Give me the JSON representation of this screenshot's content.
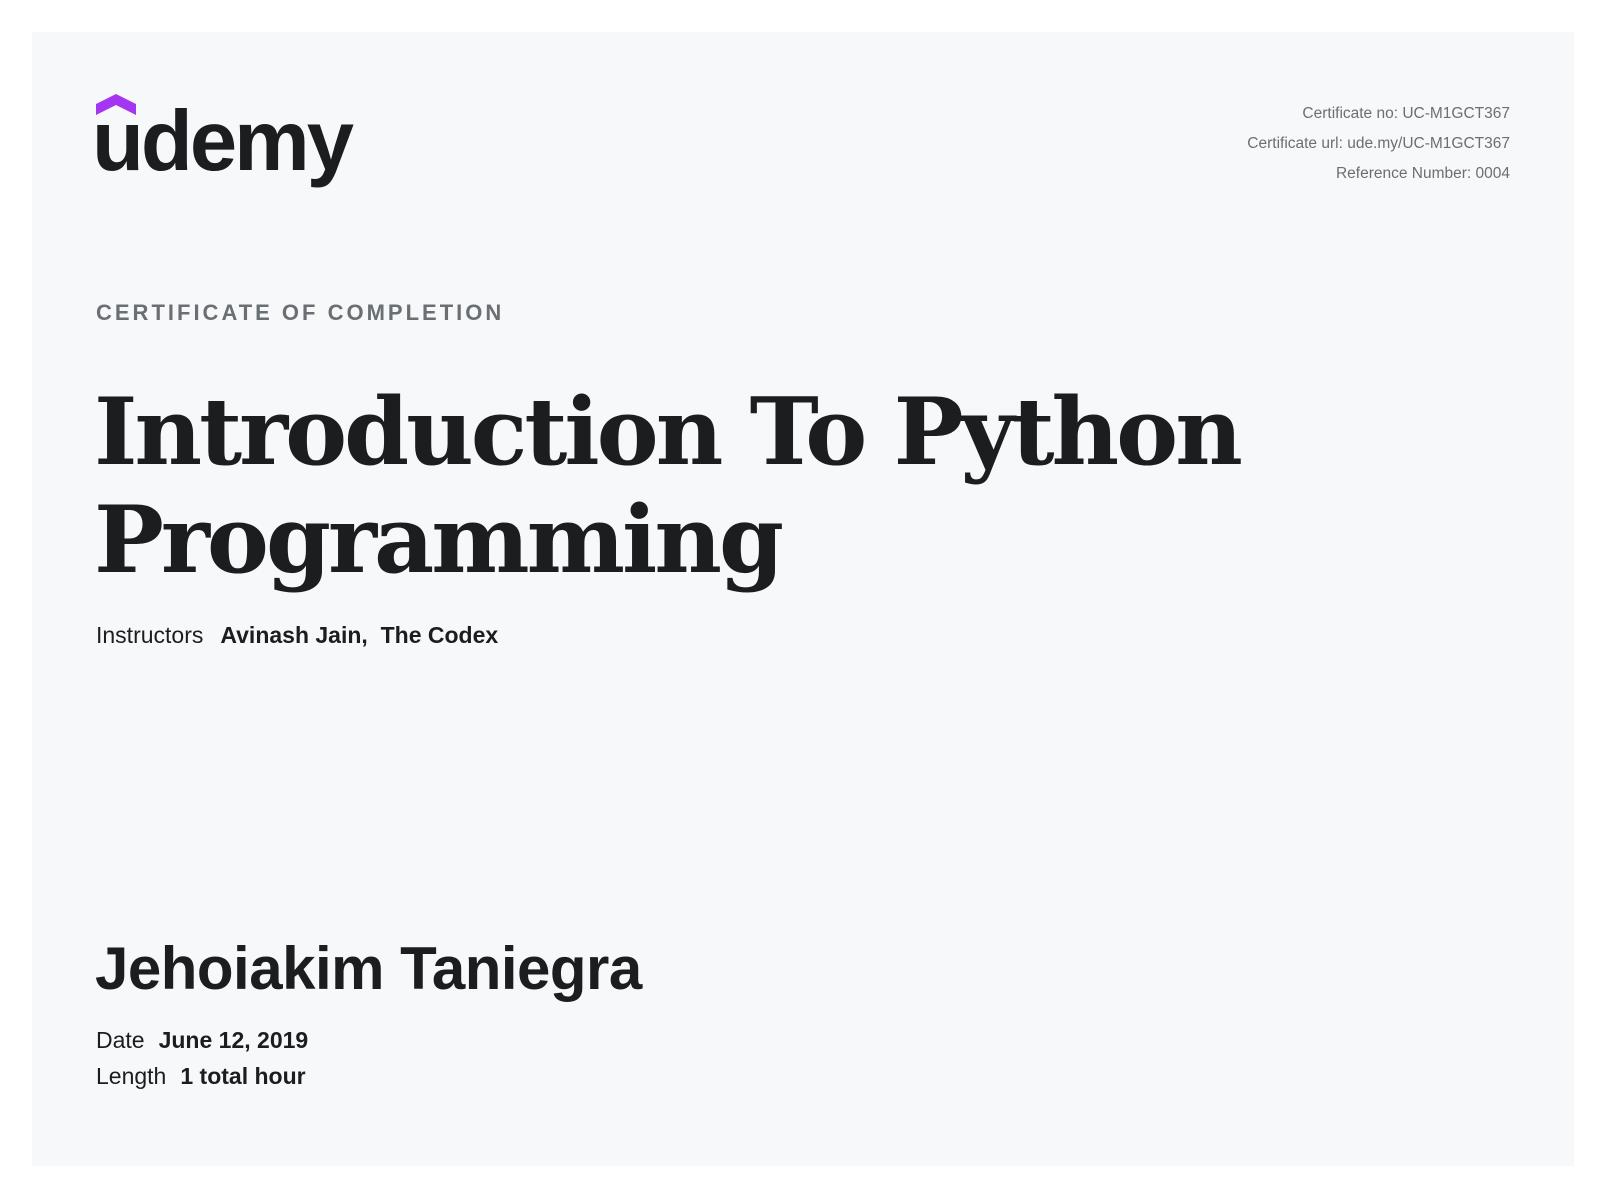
{
  "brand": {
    "logo_text": "udemy",
    "logo_color": "#1c1d1f",
    "accent_color": "#a435f0"
  },
  "meta": {
    "certificate_no": "Certificate no: UC-M1GCT367",
    "certificate_url": "Certificate url: ude.my/UC-M1GCT367",
    "reference_number": "Reference Number: 0004"
  },
  "certificate": {
    "kicker": "CERTIFICATE OF COMPLETION",
    "course_title": "Introduction To Python Programming",
    "instructors_label": "Instructors",
    "instructors": [
      "Avinash Jain",
      "The Codex"
    ],
    "instructor_separator": ",  ",
    "student_name": "Jehoiakim Taniegra",
    "date_label": "Date",
    "date_value": "June 12, 2019",
    "length_label": "Length",
    "length_value": "1 total hour"
  }
}
